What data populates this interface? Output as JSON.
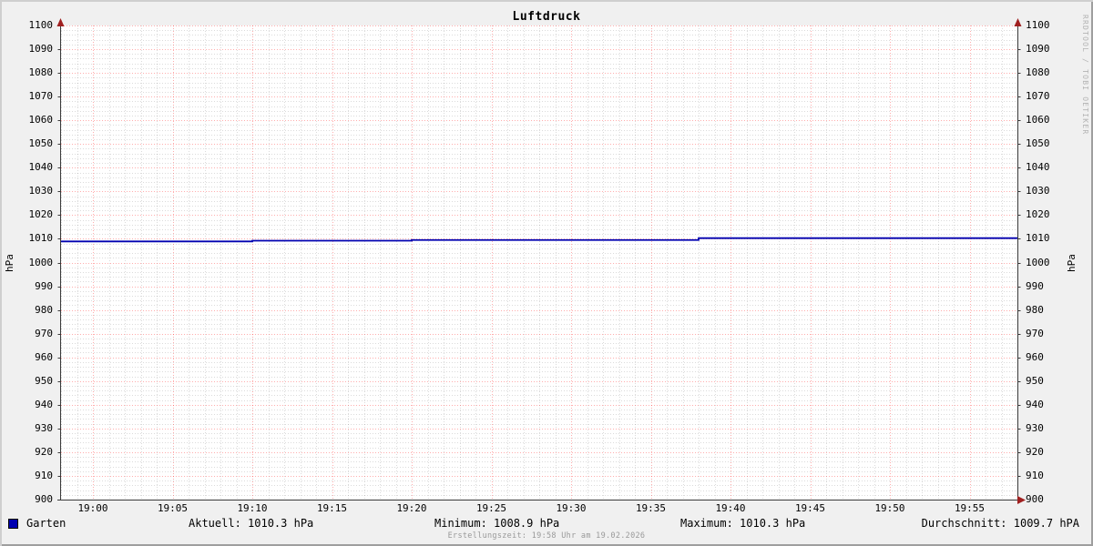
{
  "title": "Luftdruck",
  "axes": {
    "y_left_label": "hPa",
    "y_right_label": "hPa",
    "y_ticks": [
      900,
      910,
      920,
      930,
      940,
      950,
      960,
      970,
      980,
      990,
      1000,
      1010,
      1020,
      1030,
      1040,
      1050,
      1060,
      1070,
      1080,
      1090,
      1100
    ],
    "x_ticks": [
      "19:00",
      "19:05",
      "19:10",
      "19:15",
      "19:20",
      "19:25",
      "19:30",
      "19:35",
      "19:40",
      "19:45",
      "19:50",
      "19:55"
    ],
    "y_major_step": 10,
    "y_minor_step": 2,
    "x_major_step_minutes": 5,
    "x_minor_step_minutes": 1
  },
  "chart_data": {
    "type": "line",
    "title": "Luftdruck",
    "ylabel": "hPa",
    "ylim": [
      900,
      1100
    ],
    "x_range": [
      "18:58",
      "19:58"
    ],
    "grid": "on",
    "legend_position": "bottom",
    "series": [
      {
        "name": "Garten",
        "color": "#0000b0",
        "steps": [
          {
            "start": "18:58",
            "end": "19:10",
            "value": 1008.9
          },
          {
            "start": "19:10",
            "end": "19:20",
            "value": 1009.2
          },
          {
            "start": "19:20",
            "end": "19:38",
            "value": 1009.5
          },
          {
            "start": "19:38",
            "end": "19:58",
            "value": 1010.3
          }
        ]
      }
    ],
    "stats": {
      "aktuell": 1010.3,
      "minimum": 1008.9,
      "maximum": 1010.3,
      "durchschnitt": 1009.7,
      "unit": "hPa"
    }
  },
  "legend": {
    "series_label": "Garten",
    "series_color": "#0000b0",
    "stats": [
      "Aktuell: 1010.3 hPa",
      "Minimum: 1008.9 hPa",
      "Maximum: 1010.3 hPa",
      "Durchschnitt: 1009.7 hPA"
    ]
  },
  "footer": {
    "creation_text": "Erstellungszeit: 19:58 Uhr am 19.02.2026"
  },
  "watermark": "RRDTOOL / TOBI OETIKER",
  "colors": {
    "background": "#f0f0f0",
    "canvas": "#ffffff",
    "major_grid": "#ff0000",
    "minor_grid": "#999999",
    "axis": "#3a3a3a",
    "arrow": "#a02020",
    "line": "#0000b0",
    "footer_text": "#999999",
    "watermark_text": "#b3b3b3"
  }
}
